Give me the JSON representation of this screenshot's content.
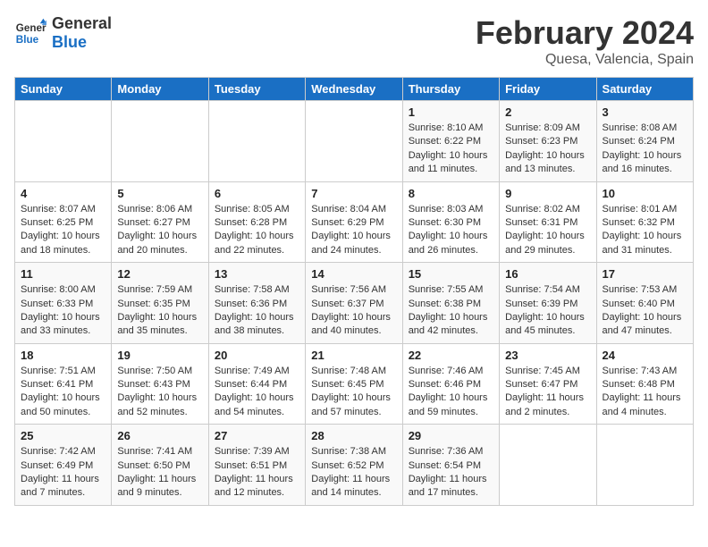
{
  "header": {
    "logo_line1": "General",
    "logo_line2": "Blue",
    "month_year": "February 2024",
    "location": "Quesa, Valencia, Spain"
  },
  "days_of_week": [
    "Sunday",
    "Monday",
    "Tuesday",
    "Wednesday",
    "Thursday",
    "Friday",
    "Saturday"
  ],
  "weeks": [
    [
      {
        "day": "",
        "info": ""
      },
      {
        "day": "",
        "info": ""
      },
      {
        "day": "",
        "info": ""
      },
      {
        "day": "",
        "info": ""
      },
      {
        "day": "1",
        "info": "Sunrise: 8:10 AM\nSunset: 6:22 PM\nDaylight: 10 hours\nand 11 minutes."
      },
      {
        "day": "2",
        "info": "Sunrise: 8:09 AM\nSunset: 6:23 PM\nDaylight: 10 hours\nand 13 minutes."
      },
      {
        "day": "3",
        "info": "Sunrise: 8:08 AM\nSunset: 6:24 PM\nDaylight: 10 hours\nand 16 minutes."
      }
    ],
    [
      {
        "day": "4",
        "info": "Sunrise: 8:07 AM\nSunset: 6:25 PM\nDaylight: 10 hours\nand 18 minutes."
      },
      {
        "day": "5",
        "info": "Sunrise: 8:06 AM\nSunset: 6:27 PM\nDaylight: 10 hours\nand 20 minutes."
      },
      {
        "day": "6",
        "info": "Sunrise: 8:05 AM\nSunset: 6:28 PM\nDaylight: 10 hours\nand 22 minutes."
      },
      {
        "day": "7",
        "info": "Sunrise: 8:04 AM\nSunset: 6:29 PM\nDaylight: 10 hours\nand 24 minutes."
      },
      {
        "day": "8",
        "info": "Sunrise: 8:03 AM\nSunset: 6:30 PM\nDaylight: 10 hours\nand 26 minutes."
      },
      {
        "day": "9",
        "info": "Sunrise: 8:02 AM\nSunset: 6:31 PM\nDaylight: 10 hours\nand 29 minutes."
      },
      {
        "day": "10",
        "info": "Sunrise: 8:01 AM\nSunset: 6:32 PM\nDaylight: 10 hours\nand 31 minutes."
      }
    ],
    [
      {
        "day": "11",
        "info": "Sunrise: 8:00 AM\nSunset: 6:33 PM\nDaylight: 10 hours\nand 33 minutes."
      },
      {
        "day": "12",
        "info": "Sunrise: 7:59 AM\nSunset: 6:35 PM\nDaylight: 10 hours\nand 35 minutes."
      },
      {
        "day": "13",
        "info": "Sunrise: 7:58 AM\nSunset: 6:36 PM\nDaylight: 10 hours\nand 38 minutes."
      },
      {
        "day": "14",
        "info": "Sunrise: 7:56 AM\nSunset: 6:37 PM\nDaylight: 10 hours\nand 40 minutes."
      },
      {
        "day": "15",
        "info": "Sunrise: 7:55 AM\nSunset: 6:38 PM\nDaylight: 10 hours\nand 42 minutes."
      },
      {
        "day": "16",
        "info": "Sunrise: 7:54 AM\nSunset: 6:39 PM\nDaylight: 10 hours\nand 45 minutes."
      },
      {
        "day": "17",
        "info": "Sunrise: 7:53 AM\nSunset: 6:40 PM\nDaylight: 10 hours\nand 47 minutes."
      }
    ],
    [
      {
        "day": "18",
        "info": "Sunrise: 7:51 AM\nSunset: 6:41 PM\nDaylight: 10 hours\nand 50 minutes."
      },
      {
        "day": "19",
        "info": "Sunrise: 7:50 AM\nSunset: 6:43 PM\nDaylight: 10 hours\nand 52 minutes."
      },
      {
        "day": "20",
        "info": "Sunrise: 7:49 AM\nSunset: 6:44 PM\nDaylight: 10 hours\nand 54 minutes."
      },
      {
        "day": "21",
        "info": "Sunrise: 7:48 AM\nSunset: 6:45 PM\nDaylight: 10 hours\nand 57 minutes."
      },
      {
        "day": "22",
        "info": "Sunrise: 7:46 AM\nSunset: 6:46 PM\nDaylight: 10 hours\nand 59 minutes."
      },
      {
        "day": "23",
        "info": "Sunrise: 7:45 AM\nSunset: 6:47 PM\nDaylight: 11 hours\nand 2 minutes."
      },
      {
        "day": "24",
        "info": "Sunrise: 7:43 AM\nSunset: 6:48 PM\nDaylight: 11 hours\nand 4 minutes."
      }
    ],
    [
      {
        "day": "25",
        "info": "Sunrise: 7:42 AM\nSunset: 6:49 PM\nDaylight: 11 hours\nand 7 minutes."
      },
      {
        "day": "26",
        "info": "Sunrise: 7:41 AM\nSunset: 6:50 PM\nDaylight: 11 hours\nand 9 minutes."
      },
      {
        "day": "27",
        "info": "Sunrise: 7:39 AM\nSunset: 6:51 PM\nDaylight: 11 hours\nand 12 minutes."
      },
      {
        "day": "28",
        "info": "Sunrise: 7:38 AM\nSunset: 6:52 PM\nDaylight: 11 hours\nand 14 minutes."
      },
      {
        "day": "29",
        "info": "Sunrise: 7:36 AM\nSunset: 6:54 PM\nDaylight: 11 hours\nand 17 minutes."
      },
      {
        "day": "",
        "info": ""
      },
      {
        "day": "",
        "info": ""
      }
    ]
  ]
}
